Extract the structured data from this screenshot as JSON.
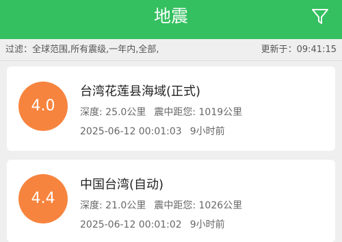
{
  "header": {
    "title": "地震",
    "filter_icon": "filter-icon"
  },
  "filterbar": {
    "text": "过滤：全球范围,所有震级,一年内,全部,",
    "updated": "更新于：09:41:15"
  },
  "colors": {
    "header": "#34c060",
    "badge": "#f7843e"
  },
  "quakes": [
    {
      "magnitude": "4.0",
      "place": "台湾花莲县海域(正式)",
      "depth": "深度: 25.0公里",
      "distance": "震中距您: 1019公里",
      "datetime": "2025-06-12 00:01:03",
      "ago": "9小时前"
    },
    {
      "magnitude": "4.4",
      "place": "中国台湾(自动)",
      "depth": "深度: 21.0公里",
      "distance": "震中距您: 1026公里",
      "datetime": "2025-06-12 00:01:02",
      "ago": "9小时前"
    }
  ]
}
